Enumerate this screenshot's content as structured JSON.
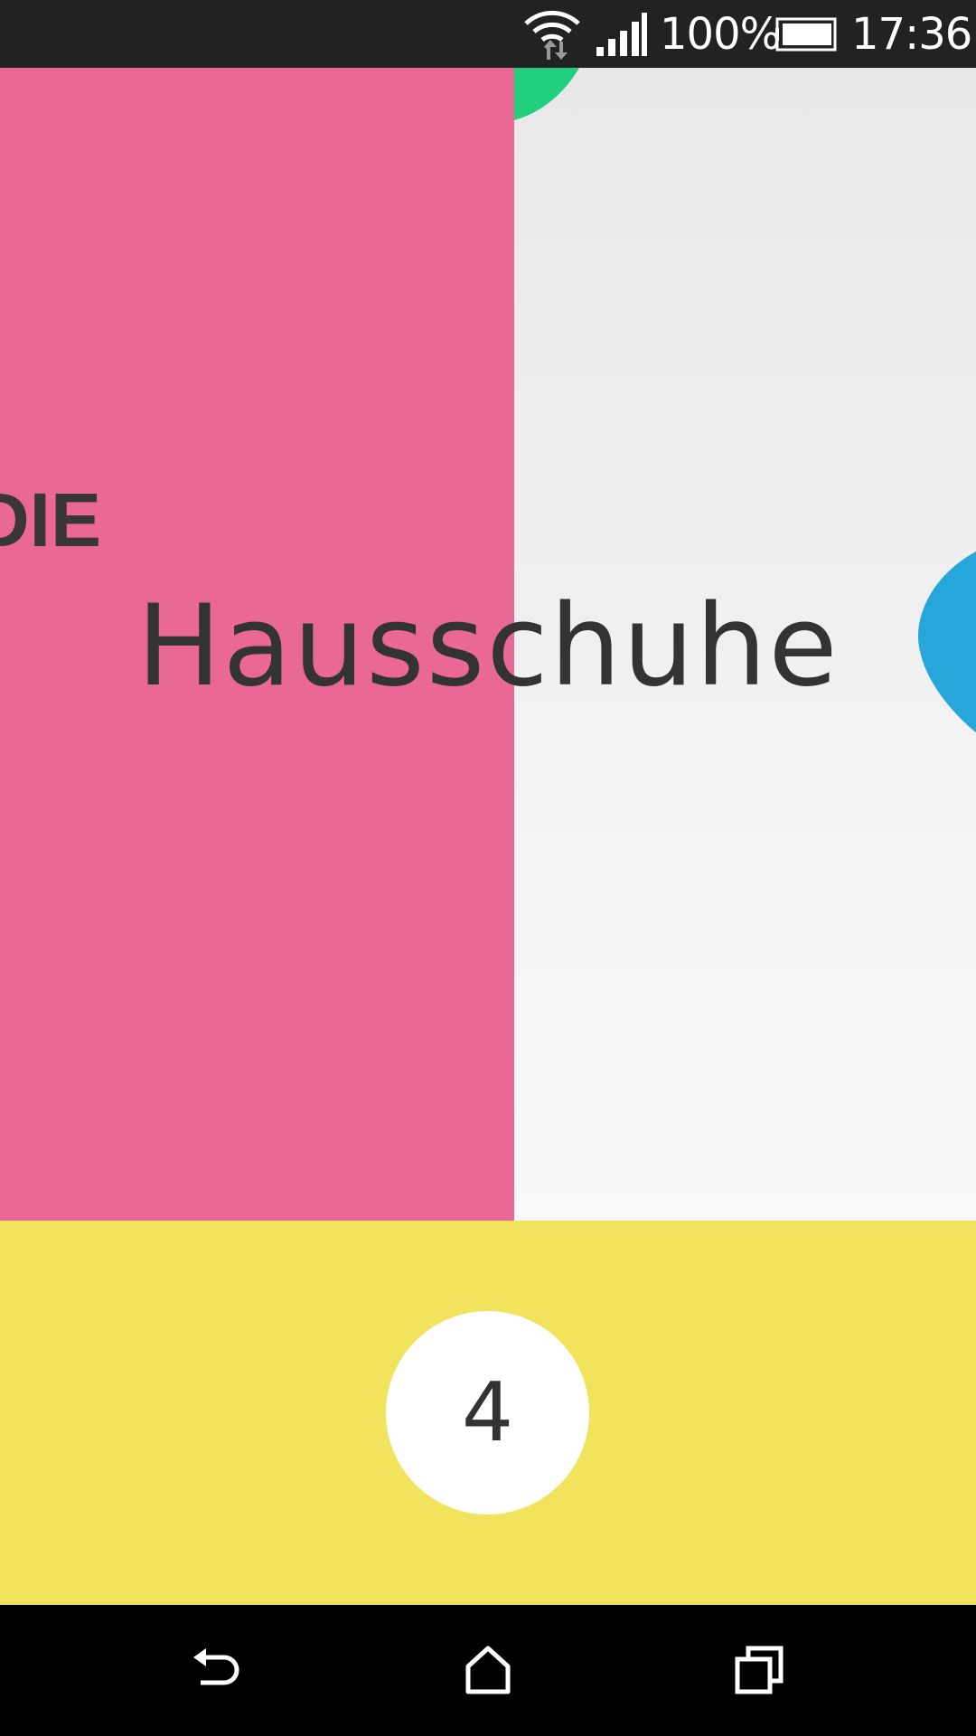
{
  "status_bar": {
    "battery_percent": "100%",
    "time": "17:36",
    "icons": [
      "wifi-icon",
      "signal-icon",
      "battery-icon"
    ]
  },
  "cards": {
    "previous_word_fragment": "DIE",
    "current_word": "Hausschuhe"
  },
  "counter": {
    "value": "4"
  },
  "nav_bar": {
    "icons": [
      "back-icon",
      "home-icon",
      "recents-icon"
    ]
  },
  "colors": {
    "pink_card": "#e96895",
    "yellow_panel": "#f2e35c",
    "green_blob": "#22cf7f",
    "blue_blob": "#26a6d9",
    "text_dark": "#333333"
  }
}
